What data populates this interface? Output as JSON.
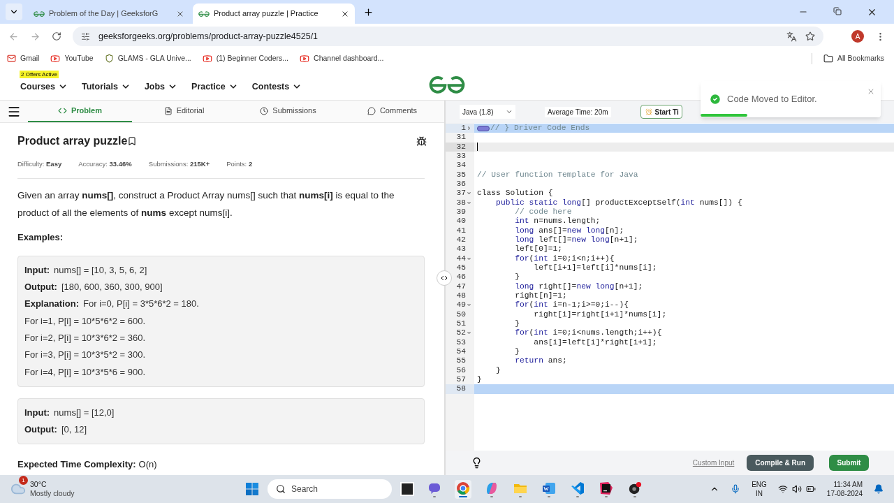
{
  "browser": {
    "tabs": [
      {
        "title": "Problem of the Day | GeeksforG",
        "selected": false
      },
      {
        "title": "Product array puzzle | Practice",
        "selected": true
      }
    ],
    "url": "geeksforgeeks.org/problems/product-array-puzzle4525/1",
    "profile_initial": "A",
    "bookmarks": [
      {
        "label": "Gmail",
        "kind": "mail"
      },
      {
        "label": "YouTube",
        "kind": "video"
      },
      {
        "label": "GLAMS - GLA Unive...",
        "kind": "crest"
      },
      {
        "label": "(1) Beginner Coders...",
        "kind": "video"
      },
      {
        "label": "Channel dashboard...",
        "kind": "video"
      }
    ],
    "all_bookmarks": "All Bookmarks"
  },
  "site_header": {
    "offer_badge": "2 Offers Active",
    "nav": [
      "Courses",
      "Tutorials",
      "Jobs",
      "Practice",
      "Contests"
    ]
  },
  "problem_tabs": [
    {
      "label": "Problem",
      "kind": "code",
      "selected": true
    },
    {
      "label": "Editorial",
      "kind": "doc",
      "selected": false
    },
    {
      "label": "Submissions",
      "kind": "clock",
      "selected": false
    },
    {
      "label": "Comments",
      "kind": "chat",
      "selected": false
    }
  ],
  "problem": {
    "title": "Product array puzzle",
    "meta": [
      {
        "label": "Difficulty:",
        "value": "Easy"
      },
      {
        "label": "Accuracy:",
        "value": "33.46%"
      },
      {
        "label": "Submissions:",
        "value": "215K+"
      },
      {
        "label": "Points:",
        "value": "2"
      }
    ],
    "description": "Given an array **nums[]**, construct a Product Array nums[] such that **nums[i]** is equal to the product of all the elements of **nums** except nums[i].",
    "examples_heading": "Examples:",
    "examples": [
      {
        "lines": [
          {
            "label": "Input:",
            "value": "nums[] = [10, 3, 5, 6, 2]"
          },
          {
            "label": "Output:",
            "value": "[180, 600, 360, 300, 900]"
          },
          {
            "label": "Explanation:",
            "value": "For i=0, P[i] = 3*5*6*2 = 180."
          },
          {
            "value": "For i=1, P[i] = 10*5*6*2 = 600."
          },
          {
            "value": "For i=2, P[i] = 10*3*6*2 = 360."
          },
          {
            "value": "For i=3, P[i] = 10*3*5*2 = 300."
          },
          {
            "value": "For i=4, P[i] = 10*3*5*6 = 900."
          }
        ]
      },
      {
        "lines": [
          {
            "label": "Input:",
            "value": "nums[] = [12,0]"
          },
          {
            "label": "Output:",
            "value": "[0, 12]"
          }
        ]
      }
    ],
    "complexity": {
      "label": "Expected Time Complexity:",
      "value": "O(n)"
    }
  },
  "editor": {
    "language": "Java (1.8)",
    "average_time": "Average Time: 20m",
    "timer_button": "Start Ti",
    "lines": [
      {
        "n": "1",
        "foldable": true,
        "folded": true,
        "highlighted": true,
        "active": false,
        "tokens": [
          {
            "text": "// } Driver Code Ends",
            "kind": "comment"
          }
        ]
      },
      {
        "n": "31",
        "foldable": false,
        "folded": false,
        "highlighted": false,
        "active": false
      },
      {
        "n": "32",
        "foldable": false,
        "folded": false,
        "highlighted": false,
        "active": true
      },
      {
        "n": "33",
        "foldable": false,
        "folded": false,
        "highlighted": false,
        "active": false
      },
      {
        "n": "34",
        "foldable": false,
        "folded": false,
        "highlighted": false,
        "active": false
      },
      {
        "n": "35",
        "foldable": false,
        "folded": false,
        "highlighted": false,
        "active": false,
        "tokens": [
          {
            "text": "// User function Template for Java",
            "kind": "comment"
          }
        ]
      },
      {
        "n": "36",
        "foldable": false,
        "folded": false,
        "highlighted": false,
        "active": false
      },
      {
        "n": "37",
        "foldable": true,
        "folded": false,
        "highlighted": false,
        "active": false,
        "tokens": [
          {
            "text": "class Solution {",
            "kind": "plain"
          }
        ]
      },
      {
        "n": "38",
        "foldable": true,
        "folded": false,
        "highlighted": false,
        "active": false,
        "tokens": [
          {
            "text": "    public static long",
            "kind": "kw"
          },
          {
            "text": "[] productExceptSelf(",
            "kind": "plain"
          },
          {
            "text": "int",
            "kind": "kw"
          },
          {
            "text": " nums[]) {",
            "kind": "plain"
          }
        ]
      },
      {
        "n": "39",
        "foldable": false,
        "folded": false,
        "highlighted": false,
        "active": false,
        "tokens": [
          {
            "text": "        // code here",
            "kind": "comment"
          }
        ]
      },
      {
        "n": "40",
        "foldable": false,
        "folded": false,
        "highlighted": false,
        "active": false,
        "tokens": [
          {
            "text": "        int",
            "kind": "kw"
          },
          {
            "text": " n=nums.length;",
            "kind": "plain"
          }
        ]
      },
      {
        "n": "41",
        "foldable": false,
        "folded": false,
        "highlighted": false,
        "active": false,
        "tokens": [
          {
            "text": "        long",
            "kind": "kw"
          },
          {
            "text": " ans[]=",
            "kind": "plain"
          },
          {
            "text": "new long",
            "kind": "kw"
          },
          {
            "text": "[n];",
            "kind": "plain"
          }
        ]
      },
      {
        "n": "42",
        "foldable": false,
        "folded": false,
        "highlighted": false,
        "active": false,
        "tokens": [
          {
            "text": "        long",
            "kind": "kw"
          },
          {
            "text": " left[]=",
            "kind": "plain"
          },
          {
            "text": "new long",
            "kind": "kw"
          },
          {
            "text": "[n+1];",
            "kind": "plain"
          }
        ]
      },
      {
        "n": "43",
        "foldable": false,
        "folded": false,
        "highlighted": false,
        "active": false,
        "tokens": [
          {
            "text": "        left[0]=1;",
            "kind": "plain"
          }
        ]
      },
      {
        "n": "44",
        "foldable": true,
        "folded": false,
        "highlighted": false,
        "active": false,
        "tokens": [
          {
            "text": "        for",
            "kind": "kw"
          },
          {
            "text": "(",
            "kind": "plain"
          },
          {
            "text": "int",
            "kind": "kw"
          },
          {
            "text": " i=0;i<n;i++){",
            "kind": "plain"
          }
        ]
      },
      {
        "n": "45",
        "foldable": false,
        "folded": false,
        "highlighted": false,
        "active": false,
        "tokens": [
          {
            "text": "            left[i+1]=left[i]*nums[i];",
            "kind": "plain"
          }
        ]
      },
      {
        "n": "46",
        "foldable": false,
        "folded": false,
        "highlighted": false,
        "active": false,
        "tokens": [
          {
            "text": "        }",
            "kind": "plain"
          }
        ]
      },
      {
        "n": "47",
        "foldable": false,
        "folded": false,
        "highlighted": false,
        "active": false,
        "tokens": [
          {
            "text": "        long",
            "kind": "kw"
          },
          {
            "text": " right[]=",
            "kind": "plain"
          },
          {
            "text": "new long",
            "kind": "kw"
          },
          {
            "text": "[n+1];",
            "kind": "plain"
          }
        ]
      },
      {
        "n": "48",
        "foldable": false,
        "folded": false,
        "highlighted": false,
        "active": false,
        "tokens": [
          {
            "text": "        right[n]=1;",
            "kind": "plain"
          }
        ]
      },
      {
        "n": "49",
        "foldable": true,
        "folded": false,
        "highlighted": false,
        "active": false,
        "tokens": [
          {
            "text": "        for",
            "kind": "kw"
          },
          {
            "text": "(",
            "kind": "plain"
          },
          {
            "text": "int",
            "kind": "kw"
          },
          {
            "text": " i=n-1;i>=0;i--){",
            "kind": "plain"
          }
        ]
      },
      {
        "n": "50",
        "foldable": false,
        "folded": false,
        "highlighted": false,
        "active": false,
        "tokens": [
          {
            "text": "            right[i]=right[i+1]*nums[i];",
            "kind": "plain"
          }
        ]
      },
      {
        "n": "51",
        "foldable": false,
        "folded": false,
        "highlighted": false,
        "active": false,
        "tokens": [
          {
            "text": "        }",
            "kind": "plain"
          }
        ]
      },
      {
        "n": "52",
        "foldable": true,
        "folded": false,
        "highlighted": false,
        "active": false,
        "tokens": [
          {
            "text": "        for",
            "kind": "kw"
          },
          {
            "text": "(",
            "kind": "plain"
          },
          {
            "text": "int",
            "kind": "kw"
          },
          {
            "text": " i=0;i<nums.length;i++){",
            "kind": "plain"
          }
        ]
      },
      {
        "n": "53",
        "foldable": false,
        "folded": false,
        "highlighted": false,
        "active": false,
        "tokens": [
          {
            "text": "            ans[i]=left[i]*right[i+1];",
            "kind": "plain"
          }
        ]
      },
      {
        "n": "54",
        "foldable": false,
        "folded": false,
        "highlighted": false,
        "active": false,
        "tokens": [
          {
            "text": "        }",
            "kind": "plain"
          }
        ]
      },
      {
        "n": "55",
        "foldable": false,
        "folded": false,
        "highlighted": false,
        "active": false,
        "tokens": [
          {
            "text": "        return",
            "kind": "kw"
          },
          {
            "text": " ans;",
            "kind": "plain"
          }
        ]
      },
      {
        "n": "56",
        "foldable": false,
        "folded": false,
        "highlighted": false,
        "active": false,
        "tokens": [
          {
            "text": "    }",
            "kind": "plain"
          }
        ]
      },
      {
        "n": "57",
        "foldable": false,
        "folded": false,
        "highlighted": false,
        "active": false,
        "tokens": [
          {
            "text": "}",
            "kind": "plain"
          }
        ]
      },
      {
        "n": "58",
        "foldable": false,
        "folded": false,
        "highlighted": true,
        "active": false
      }
    ],
    "custom_input": "Custom Input",
    "compile_button": "Compile & Run",
    "submit_button": "Submit"
  },
  "toast": {
    "message": "Code Moved to Editor.",
    "level": 0.26
  },
  "taskbar": {
    "weather_badge": "1",
    "temperature": "30°C",
    "weather": "Mostly cloudy",
    "search_placeholder": "Search",
    "apps": [
      {
        "kind": "chat",
        "active": false
      },
      {
        "kind": "browser",
        "active": true
      },
      {
        "kind": "copilot",
        "active": false
      },
      {
        "kind": "folder",
        "active": false
      },
      {
        "kind": "word",
        "active": false
      },
      {
        "kind": "vscode",
        "active": false
      },
      {
        "kind": "ide",
        "active": false
      },
      {
        "kind": "recorder",
        "active": false
      }
    ],
    "language": "ENG",
    "region": "IN",
    "time": "11:34 AM",
    "date": "17-08-2024"
  }
}
